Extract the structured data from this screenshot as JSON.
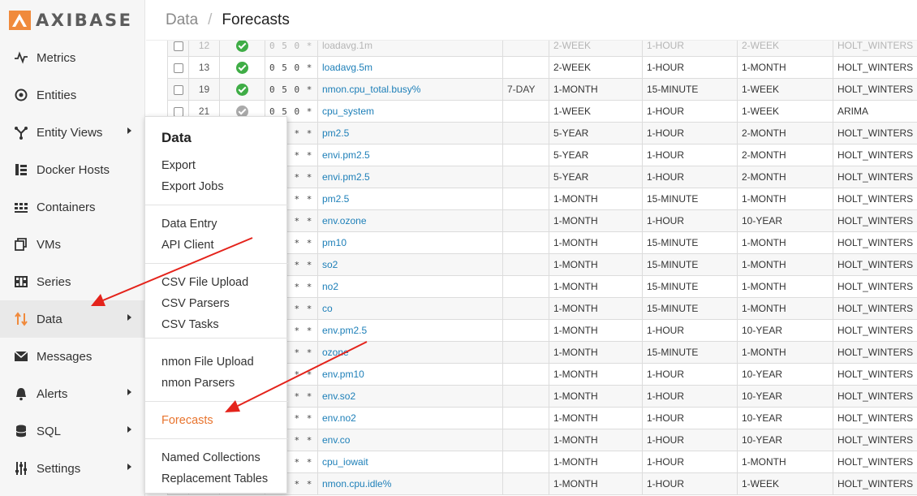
{
  "brand": {
    "name": "AXIBASE"
  },
  "header": {
    "parent": "Data",
    "separator": "/",
    "current": "Forecasts"
  },
  "sidebar": {
    "items": [
      {
        "label": "Metrics",
        "icon": "metrics-icon",
        "caret": false,
        "active": false
      },
      {
        "label": "Entities",
        "icon": "entities-icon",
        "caret": false,
        "active": false
      },
      {
        "label": "Entity Views",
        "icon": "entity-views-icon",
        "caret": true,
        "active": false
      },
      {
        "label": "Docker Hosts",
        "icon": "docker-hosts-icon",
        "caret": false,
        "active": false
      },
      {
        "label": "Containers",
        "icon": "containers-icon",
        "caret": false,
        "active": false
      },
      {
        "label": "VMs",
        "icon": "vms-icon",
        "caret": false,
        "active": false
      },
      {
        "label": "Series",
        "icon": "series-icon",
        "caret": false,
        "active": false
      },
      {
        "label": "Data",
        "icon": "data-icon",
        "caret": true,
        "active": true
      },
      {
        "label": "Messages",
        "icon": "messages-icon",
        "caret": false,
        "active": false
      },
      {
        "label": "Alerts",
        "icon": "alerts-icon",
        "caret": true,
        "active": false
      },
      {
        "label": "SQL",
        "icon": "sql-icon",
        "caret": true,
        "active": false
      },
      {
        "label": "Settings",
        "icon": "settings-icon",
        "caret": true,
        "active": false
      }
    ]
  },
  "dropdown": {
    "title": "Data",
    "groups": [
      [
        "Export",
        "Export Jobs"
      ],
      [
        "Data Entry",
        "API Client"
      ],
      [
        "CSV File Upload",
        "CSV Parsers",
        "CSV Tasks"
      ],
      [
        "nmon File Upload",
        "nmon Parsers"
      ],
      [
        "Forecasts"
      ],
      [
        "Named Collections",
        "Replacement Tables"
      ]
    ],
    "active": "Forecasts",
    "active_color": "#e8742e"
  },
  "table": {
    "rows": [
      {
        "id": "12",
        "status": "ok",
        "days": "0 5 0 * * *",
        "metric": "loadavg.1m",
        "filter": "",
        "retention": "2-WEEK",
        "period": "1-HOUR",
        "horizon": "2-WEEK",
        "algorithm": "HOLT_WINTERS",
        "faded": true
      },
      {
        "id": "13",
        "status": "ok",
        "days": "0 5 0 * * *",
        "metric": "loadavg.5m",
        "filter": "",
        "retention": "2-WEEK",
        "period": "1-HOUR",
        "horizon": "1-MONTH",
        "algorithm": "HOLT_WINTERS"
      },
      {
        "id": "19",
        "status": "ok",
        "days": "0 5 0 * * *",
        "metric": "nmon.cpu_total.busy%",
        "filter": "7-DAY",
        "retention": "1-MONTH",
        "period": "15-MINUTE",
        "horizon": "1-WEEK",
        "algorithm": "HOLT_WINTERS"
      },
      {
        "id": "21",
        "status": "gray",
        "days": "0 5 0 * * *",
        "metric": "cpu_system",
        "filter": "",
        "retention": "1-WEEK",
        "period": "1-HOUR",
        "horizon": "1-WEEK",
        "algorithm": "ARIMA"
      },
      {
        "id": "",
        "status": "",
        "days": "0 * * *",
        "metric": "pm2.5",
        "filter": "",
        "retention": "5-YEAR",
        "period": "1-HOUR",
        "horizon": "2-MONTH",
        "algorithm": "HOLT_WINTERS"
      },
      {
        "id": "",
        "status": "",
        "days": "0 * * *",
        "metric": "envi.pm2.5",
        "filter": "",
        "retention": "5-YEAR",
        "period": "1-HOUR",
        "horizon": "2-MONTH",
        "algorithm": "HOLT_WINTERS"
      },
      {
        "id": "",
        "status": "",
        "days": "0 * * *",
        "metric": "envi.pm2.5",
        "filter": "",
        "retention": "5-YEAR",
        "period": "1-HOUR",
        "horizon": "2-MONTH",
        "algorithm": "HOLT_WINTERS"
      },
      {
        "id": "",
        "status": "",
        "days": "0 * * *",
        "metric": "pm2.5",
        "filter": "",
        "retention": "1-MONTH",
        "period": "15-MINUTE",
        "horizon": "1-MONTH",
        "algorithm": "HOLT_WINTERS"
      },
      {
        "id": "",
        "status": "",
        "days": "0 * * *",
        "metric": "env.ozone",
        "filter": "",
        "retention": "1-MONTH",
        "period": "1-HOUR",
        "horizon": "10-YEAR",
        "algorithm": "HOLT_WINTERS"
      },
      {
        "id": "",
        "status": "",
        "days": "0 * * *",
        "metric": "pm10",
        "filter": "",
        "retention": "1-MONTH",
        "period": "15-MINUTE",
        "horizon": "1-MONTH",
        "algorithm": "HOLT_WINTERS"
      },
      {
        "id": "",
        "status": "",
        "days": "0 * * *",
        "metric": "so2",
        "filter": "",
        "retention": "1-MONTH",
        "period": "15-MINUTE",
        "horizon": "1-MONTH",
        "algorithm": "HOLT_WINTERS"
      },
      {
        "id": "",
        "status": "",
        "days": "0 * * *",
        "metric": "no2",
        "filter": "",
        "retention": "1-MONTH",
        "period": "15-MINUTE",
        "horizon": "1-MONTH",
        "algorithm": "HOLT_WINTERS"
      },
      {
        "id": "",
        "status": "",
        "days": "0 * * *",
        "metric": "co",
        "filter": "",
        "retention": "1-MONTH",
        "period": "15-MINUTE",
        "horizon": "1-MONTH",
        "algorithm": "HOLT_WINTERS"
      },
      {
        "id": "",
        "status": "",
        "days": "0 * * *",
        "metric": "env.pm2.5",
        "filter": "",
        "retention": "1-MONTH",
        "period": "1-HOUR",
        "horizon": "10-YEAR",
        "algorithm": "HOLT_WINTERS"
      },
      {
        "id": "",
        "status": "",
        "days": "0 * * *",
        "metric": "ozone",
        "filter": "",
        "retention": "1-MONTH",
        "period": "15-MINUTE",
        "horizon": "1-MONTH",
        "algorithm": "HOLT_WINTERS"
      },
      {
        "id": "",
        "status": "",
        "days": "0 * * *",
        "metric": "env.pm10",
        "filter": "",
        "retention": "1-MONTH",
        "period": "1-HOUR",
        "horizon": "10-YEAR",
        "algorithm": "HOLT_WINTERS"
      },
      {
        "id": "",
        "status": "",
        "days": "0 * * *",
        "metric": "env.so2",
        "filter": "",
        "retention": "1-MONTH",
        "period": "1-HOUR",
        "horizon": "10-YEAR",
        "algorithm": "HOLT_WINTERS"
      },
      {
        "id": "",
        "status": "",
        "days": "0 * * *",
        "metric": "env.no2",
        "filter": "",
        "retention": "1-MONTH",
        "period": "1-HOUR",
        "horizon": "10-YEAR",
        "algorithm": "HOLT_WINTERS"
      },
      {
        "id": "",
        "status": "",
        "days": "0 * * *",
        "metric": "env.co",
        "filter": "",
        "retention": "1-MONTH",
        "period": "1-HOUR",
        "horizon": "10-YEAR",
        "algorithm": "HOLT_WINTERS"
      },
      {
        "id": "",
        "status": "",
        "days": "0 * * *",
        "metric": "cpu_iowait",
        "filter": "",
        "retention": "1-MONTH",
        "period": "1-HOUR",
        "horizon": "1-MONTH",
        "algorithm": "HOLT_WINTERS"
      },
      {
        "id": "",
        "status": "",
        "days": "0 * * *",
        "metric": "nmon.cpu.idle%",
        "filter": "",
        "retention": "1-MONTH",
        "period": "1-HOUR",
        "horizon": "1-WEEK",
        "algorithm": "HOLT_WINTERS"
      }
    ]
  },
  "annotations": {
    "arrow_color": "#e4231b"
  }
}
